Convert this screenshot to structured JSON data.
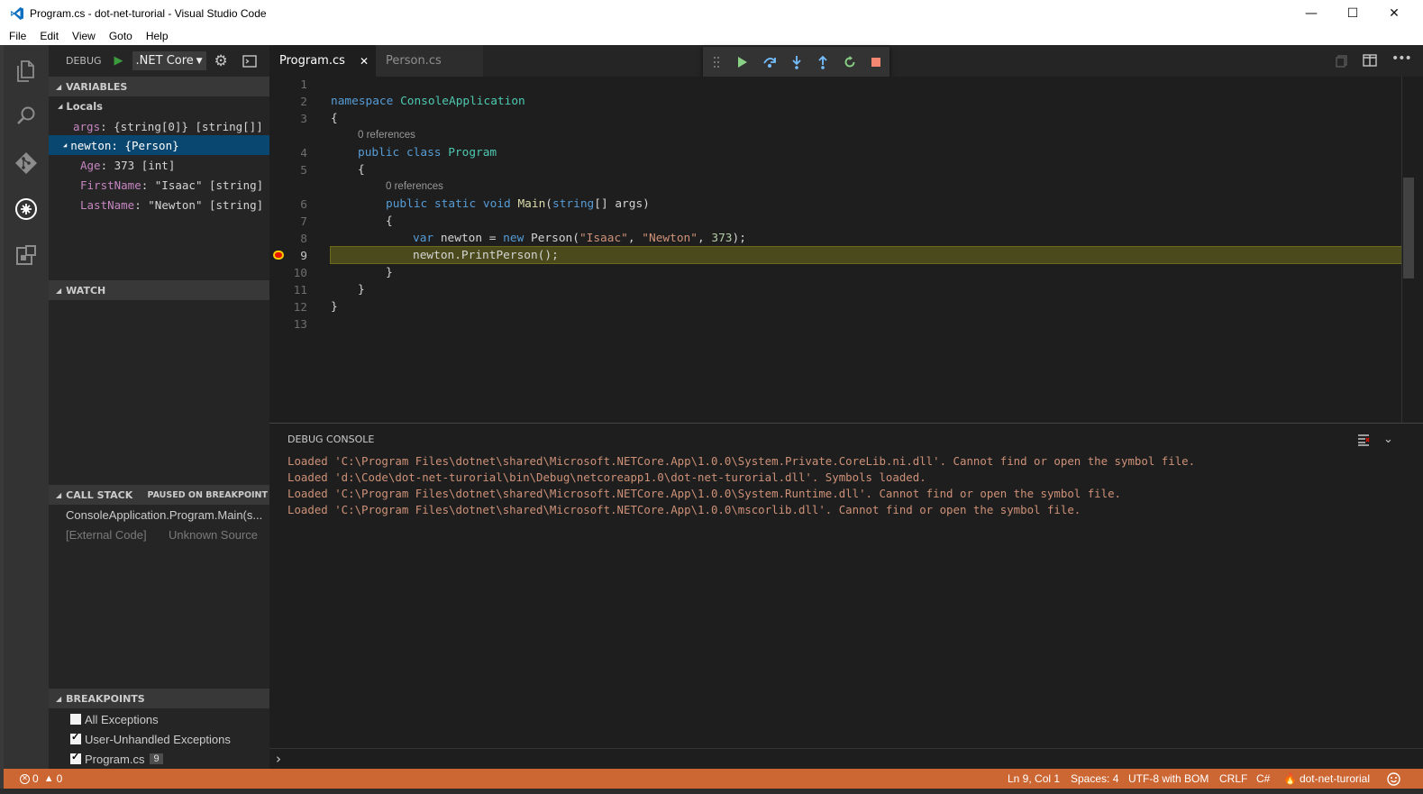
{
  "window": {
    "title": "Program.cs - dot-net-turorial - Visual Studio Code",
    "controls": [
      "—",
      "☐",
      "✕"
    ]
  },
  "menu": [
    "File",
    "Edit",
    "View",
    "Goto",
    "Help"
  ],
  "sidebar": {
    "debug_label": "DEBUG",
    "config": ".NET Core",
    "variables": {
      "header": "VARIABLES",
      "locals_label": "Locals",
      "rows": [
        {
          "name": "args",
          "value": ": {string[0]} [string[]]"
        },
        {
          "name": "newton",
          "value": ": {Person}"
        },
        {
          "name": "Age",
          "value": ": 373 [int]"
        },
        {
          "name": "FirstName",
          "value": ": \"Isaac\" [string]"
        },
        {
          "name": "LastName",
          "value": ": \"Newton\" [string]"
        }
      ]
    },
    "watch": {
      "header": "WATCH"
    },
    "callstack": {
      "header": "CALL STACK",
      "status": "PAUSED ON BREAKPOINT",
      "frames": [
        {
          "name": "ConsoleApplication.Program.Main(s...",
          "source": ""
        },
        {
          "name": "[External Code]",
          "source": "Unknown Source"
        }
      ]
    },
    "breakpoints": {
      "header": "BREAKPOINTS",
      "items": [
        {
          "label": "All Exceptions",
          "checked": false,
          "line": ""
        },
        {
          "label": "User-Unhandled Exceptions",
          "checked": true,
          "line": ""
        },
        {
          "label": "Program.cs",
          "checked": true,
          "line": "9"
        }
      ]
    }
  },
  "tabs": [
    {
      "label": "Program.cs",
      "close": "✕"
    },
    {
      "label": "Person.cs"
    }
  ],
  "editor": {
    "line_numbers": [
      "1",
      "2",
      "3",
      "4",
      "5",
      "6",
      "7",
      "8",
      "9",
      "10",
      "11",
      "12",
      "13"
    ],
    "lens": "0 references",
    "code": {
      "ns_kw": "namespace",
      "ns_name": "ConsoleApplication",
      "open_brace": "{",
      "close_brace": "}",
      "public_kw": "public",
      "class_kw": "class",
      "class_name": "Program",
      "static_kw": "static",
      "void_kw": "void",
      "main_fn": "Main",
      "string_kw": "string",
      "args_param": "[] args)",
      "var_kw": "var",
      "var_decl": " newton = ",
      "new_kw": "new",
      "person_call": " Person(",
      "str_isaac": "\"Isaac\"",
      "comma": ", ",
      "str_newton": "\"Newton\"",
      "num_373": "373",
      "close_call": ");",
      "print_call": "newton.PrintPerson();"
    }
  },
  "panel": {
    "title": "DEBUG CONSOLE",
    "lines": [
      "Loaded 'C:\\Program Files\\dotnet\\shared\\Microsoft.NETCore.App\\1.0.0\\System.Private.CoreLib.ni.dll'. Cannot find or open the symbol file.",
      "Loaded 'd:\\Code\\dot-net-turorial\\bin\\Debug\\netcoreapp1.0\\dot-net-turorial.dll'. Symbols loaded.",
      "Loaded 'C:\\Program Files\\dotnet\\shared\\Microsoft.NETCore.App\\1.0.0\\System.Runtime.dll'. Cannot find or open the symbol file.",
      "Loaded 'C:\\Program Files\\dotnet\\shared\\Microsoft.NETCore.App\\1.0.0\\mscorlib.dll'. Cannot find or open the symbol file."
    ],
    "prompt": "›"
  },
  "statusbar": {
    "errors": "0",
    "warnings": "0",
    "position": "Ln 9, Col 1",
    "spaces": "Spaces: 4",
    "encoding": "UTF-8 with BOM",
    "eol": "CRLF",
    "language": "C#",
    "project": "dot-net-turorial"
  },
  "colors": {
    "statusbar": "#cc6633",
    "selection": "#094771",
    "current_line": "#4b4a1d"
  }
}
